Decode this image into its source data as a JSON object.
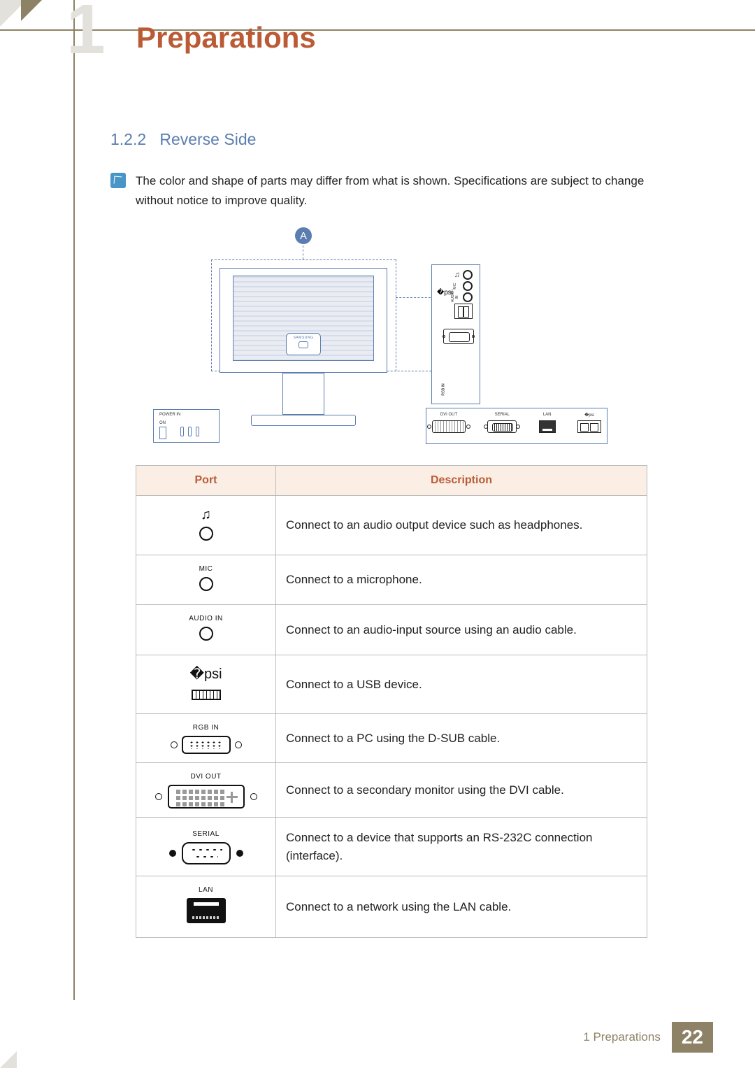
{
  "chapter": {
    "number": "1",
    "title": "Preparations"
  },
  "section": {
    "number": "1.2.2",
    "title": "Reverse Side"
  },
  "note": "The color and shape of parts may differ from what is shown. Specifications are subject to change without notice to improve quality.",
  "diagram": {
    "callout": "A",
    "brand": "SAMSUNG",
    "power_box": {
      "label": "POWER IN",
      "switch": "ON"
    },
    "side_panel": {
      "headphone": "",
      "mic": "MIC",
      "audio_in": "AUDIO IN",
      "usb": "",
      "rgb_in": "RGB IN"
    },
    "bottom_panel": {
      "dvi_out": "DVI OUT",
      "serial": "SERIAL",
      "lan": "LAN",
      "usb": ""
    }
  },
  "table": {
    "headers": {
      "port": "Port",
      "description": "Description"
    },
    "rows": [
      {
        "label": "",
        "type": "headphone",
        "desc": "Connect to an audio output device such as headphones."
      },
      {
        "label": "MIC",
        "type": "jack",
        "desc": "Connect to a microphone."
      },
      {
        "label": "AUDIO IN",
        "type": "jack",
        "desc": "Connect to an audio-input source using an audio cable."
      },
      {
        "label": "",
        "type": "usb",
        "desc": "Connect to a USB device."
      },
      {
        "label": "RGB IN",
        "type": "vga",
        "desc": "Connect to a PC using the D-SUB cable."
      },
      {
        "label": "DVI OUT",
        "type": "dvi",
        "desc": "Connect to a secondary monitor using the DVI cable."
      },
      {
        "label": "SERIAL",
        "type": "serial",
        "desc": "Connect to a device that supports an RS-232C connection (interface)."
      },
      {
        "label": "LAN",
        "type": "lan",
        "desc": "Connect to a network using the LAN cable."
      }
    ]
  },
  "footer": {
    "chapter_ref": "1 Preparations",
    "page": "22"
  }
}
